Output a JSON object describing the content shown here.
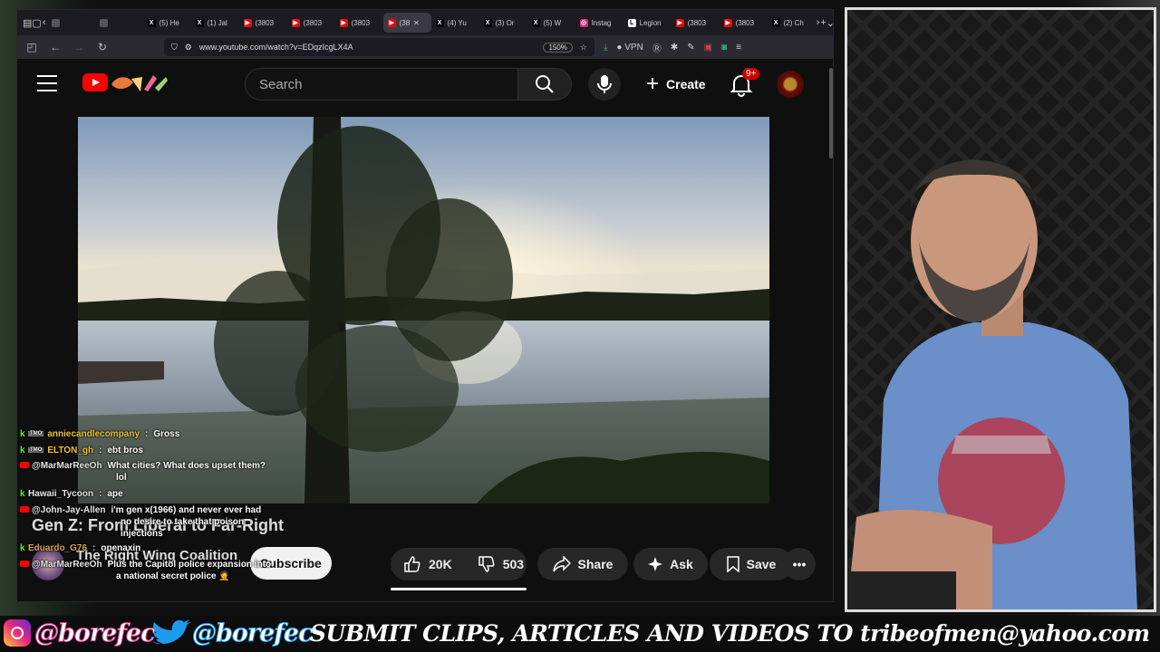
{
  "browser": {
    "tabs": [
      {
        "label": "",
        "icon": "generic"
      },
      {
        "label": "",
        "icon": "generic"
      },
      {
        "label": "(5) He",
        "icon": "x"
      },
      {
        "label": "(1) Jal",
        "icon": "x"
      },
      {
        "label": "(3803",
        "icon": "youtube"
      },
      {
        "label": "(3803",
        "icon": "youtube"
      },
      {
        "label": "(3803",
        "icon": "youtube"
      },
      {
        "label": "(38",
        "icon": "youtube",
        "active": true
      },
      {
        "label": "(4) Yu",
        "icon": "x"
      },
      {
        "label": "(3) Or",
        "icon": "x"
      },
      {
        "label": "(5) W",
        "icon": "x"
      },
      {
        "label": "Instag",
        "icon": "instagram"
      },
      {
        "label": "Legion",
        "icon": "l"
      },
      {
        "label": "(3803",
        "icon": "youtube"
      },
      {
        "label": "(3803",
        "icon": "youtube"
      },
      {
        "label": "(2) Ch",
        "icon": "x"
      }
    ],
    "url": "www.youtube.com/watch?v=EDqzIcgLX4A",
    "zoom": "150%",
    "vpn_label": "VPN"
  },
  "youtube": {
    "search_placeholder": "Search",
    "create_label": "Create",
    "notification_count": "9+",
    "video_title": "Gen Z: From Liberal to Far-Right",
    "channel_name": "The Right Wing Coalition",
    "subscribe_label": "Subscribe",
    "likes": "20K",
    "dislikes": "503",
    "share_label": "Share",
    "ask_label": "Ask",
    "save_label": "Save"
  },
  "chat": [
    {
      "platform": "kick",
      "badge": "TMO",
      "user": "anniecandlecompany",
      "text": "Gross",
      "color": "#f4c430"
    },
    {
      "platform": "kick",
      "badge": "TMO",
      "user": "ELTON_gh",
      "text": "ebt bros",
      "color": "#f4c430"
    },
    {
      "platform": "youtube",
      "user": "@MarMarReeOh",
      "text": "What cities? What does upset them?",
      "text2": "lol",
      "color": "#e6e6e6"
    },
    {
      "platform": "kick",
      "user": "Hawaii_Tycoon",
      "text": "ape",
      "color": "#e6e6e6"
    },
    {
      "platform": "youtube",
      "user": "@John-Jay-Allen",
      "text": "i'm gen x(1966) and never ever had",
      "text2": "no desire to take that poison",
      "text3": "injections",
      "color": "#e6e6e6"
    },
    {
      "platform": "kick",
      "user": "Eduardo_G76",
      "text": "openaxin",
      "color": "#d9a440"
    },
    {
      "platform": "youtube",
      "user": "@MarMarReeOh",
      "text": "Plus the Capitol police expansion into",
      "text2": "a national secret police 🤦",
      "color": "#e6e6e6"
    }
  ],
  "banner": {
    "instagram_handle": "@borefec",
    "twitter_handle": "@borefec",
    "submit_text": "SUBMIT CLIPS, ARTICLES AND VIDEOS TO tribeofmen@yahoo.com"
  }
}
